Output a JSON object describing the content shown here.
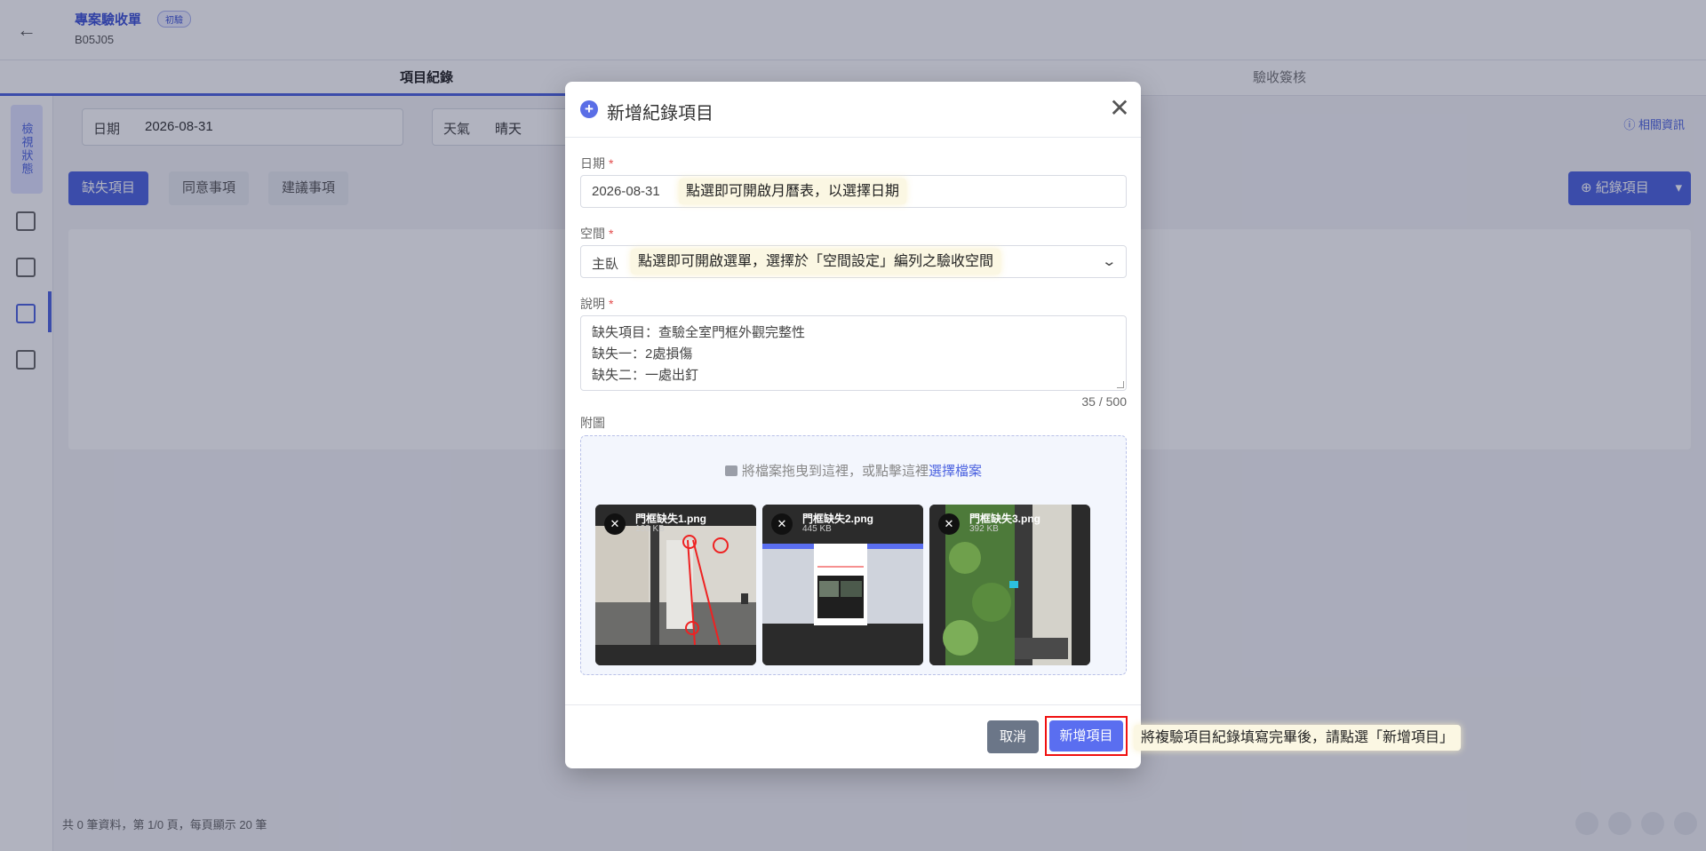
{
  "app": {
    "back_icon": "arrow-left-icon",
    "project_title": "專案驗收單",
    "project_badge": "初驗",
    "project_code": "B05J05",
    "tabs": [
      {
        "label": "項目紀錄",
        "active": true
      },
      {
        "label": "驗收簽核",
        "active": false
      }
    ],
    "sidebar_label": "檢視狀態",
    "filters": {
      "date_label": "日期",
      "date_value": "2026-08-31",
      "weather_label": "天氣",
      "weather_value": "晴天"
    },
    "info_link": "相關資訊",
    "categories": [
      "缺失項目",
      "同意事項",
      "建議事項"
    ],
    "record_button": "紀錄項目",
    "footer_text": "共 0 筆資料，第 1/0 頁，每頁顯示 20 筆"
  },
  "modal": {
    "title": "新增紀錄項目",
    "date": {
      "label": "日期",
      "required_mark": "*",
      "value": "2026-08-31",
      "hint": "點選即可開啟月曆表，以選擇日期"
    },
    "space": {
      "label": "空間",
      "required_mark": "*",
      "value": "主臥",
      "hint": "點選即可開啟選單，選擇於「空間設定」編列之驗收空間"
    },
    "description": {
      "label": "說明",
      "required_mark": "*",
      "lines": [
        "缺失項目：查驗全室門框外觀完整性",
        "缺失一：2處損傷",
        "缺失二：一處出釘"
      ],
      "counter": "35 / 500"
    },
    "attachments": {
      "label": "附圖",
      "drop_text": "將檔案拖曳到這裡，或點擊這裡",
      "select_link": "選擇檔案",
      "files": [
        {
          "name": "門框缺失1.png",
          "size": "108 KB"
        },
        {
          "name": "門框缺失2.png",
          "size": "445 KB"
        },
        {
          "name": "門框缺失3.png",
          "size": "392 KB"
        }
      ]
    },
    "cancel_label": "取消",
    "submit_label": "新增項目",
    "submit_hint": "將複驗項目紀錄填寫完畢後，請點選「新增項目」"
  },
  "colors": {
    "accent": "#4c63e0",
    "hint_background": "#fbf7e3",
    "highlight_border": "#f01010"
  }
}
